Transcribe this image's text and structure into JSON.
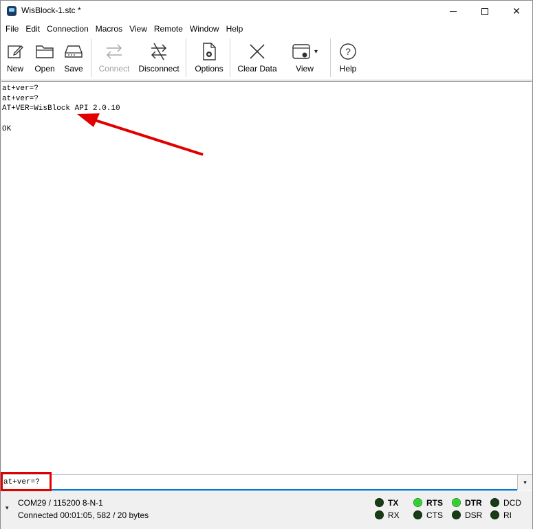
{
  "window": {
    "title": "WisBlock-1.stc *",
    "controls": {
      "minimize_icon": "minimize-icon",
      "maximize_icon": "maximize-icon",
      "close_icon": "close-icon",
      "close_glyph": "✕"
    }
  },
  "menu": [
    "File",
    "Edit",
    "Connection",
    "Macros",
    "View",
    "Remote",
    "Window",
    "Help"
  ],
  "toolbar": {
    "new": "New",
    "open": "Open",
    "save": "Save",
    "connect": "Connect",
    "disconnect": "Disconnect",
    "options": "Options",
    "clear_data": "Clear Data",
    "view": "View",
    "help": "Help",
    "help_glyph": "?",
    "view_caret": "▾",
    "connect_enabled": false
  },
  "terminal": {
    "lines": [
      "at+ver=?",
      "at+ver=?",
      "AT+VER=WisBlock API 2.0.10",
      "",
      "OK"
    ],
    "annotation_color": "#e00000"
  },
  "send": {
    "value": "at+ver=?",
    "dropdown_glyph": "▾"
  },
  "status": {
    "chevron": "▾",
    "port": "COM29 / 115200 8-N-1",
    "connection": "Connected 00:01:05, 582 / 20 bytes",
    "signals": {
      "tx": "TX",
      "rx": "RX",
      "rts": "RTS",
      "cts": "CTS",
      "dtr": "DTR",
      "dsr": "DSR",
      "dcd": "DCD",
      "ri": "RI"
    },
    "active_signals": [
      "RTS",
      "DTR"
    ],
    "led_on_color": "#2fcf2f",
    "led_off_color": "#173d17"
  }
}
